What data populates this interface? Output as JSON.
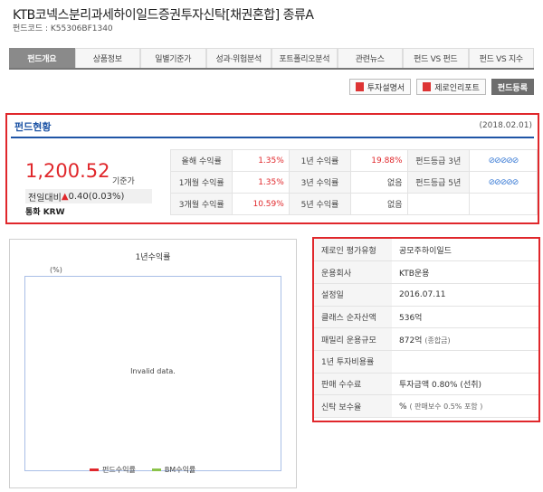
{
  "fund": {
    "name": "KTB코넥스분리과세하이일드증권투자신탁[채권혼합] 종류A",
    "code_label": "펀드코드 : K55306BF1340"
  },
  "tabs": [
    "펀드개요",
    "상품정보",
    "일별기준가",
    "성과·위험분석",
    "포트폴리오분석",
    "관련뉴스",
    "펀드 VS 펀드",
    "펀드 VS 지수"
  ],
  "buttons": {
    "prospectus": "투자설명서",
    "zeroin_report": "제로인리포트",
    "register": "펀드등록"
  },
  "status": {
    "title": "펀드현황",
    "date": "(2018.02.01)",
    "price": "1,200.52",
    "price_label": "기준가",
    "change_label": "전일대비",
    "change_arrow": "▲",
    "change_value": "0.40(0.03%)",
    "currency": "통화 KRW",
    "returns": {
      "ytd_label": "올해 수익률",
      "ytd": "1.35%",
      "y1_label": "1년 수익률",
      "y1": "19.88%",
      "grade3_label": "펀드등급 3년",
      "grade3": "⊘⊘⊘⊘⊘",
      "m1_label": "1개월 수익률",
      "m1": "1.35%",
      "y3_label": "3년 수익률",
      "y3": "없음",
      "grade5_label": "펀드등급 5년",
      "grade5": "⊘⊘⊘⊘⊘",
      "m3_label": "3개월 수익률",
      "m3": "10.59%",
      "y5_label": "5년 수익률",
      "y5": "없음"
    }
  },
  "chart": {
    "title": "1년수익률",
    "unit": "(%)",
    "message": "Invalid data.",
    "legend_fund": "펀드수익률",
    "legend_bm": "BM수익률",
    "fund_color": "#e0272b",
    "bm_color": "#8bc34a"
  },
  "info": {
    "rows": [
      {
        "label": "제로인 평가유형",
        "value": "공모주하이일드",
        "sub": ""
      },
      {
        "label": "운용회사",
        "value": "KTB운용",
        "sub": ""
      },
      {
        "label": "설정일",
        "value": "2016.07.11",
        "sub": ""
      },
      {
        "label": "클래스 순자산액",
        "value": "536억",
        "sub": ""
      },
      {
        "label": "패밀리 운용규모",
        "value": "872억",
        "sub": "(종합금)"
      },
      {
        "label": "1년 투자비용률",
        "value": "",
        "sub": ""
      },
      {
        "label": "판매 수수료",
        "value": "투자금액 0.80% (선취)",
        "sub": ""
      },
      {
        "label": "신탁 보수율",
        "value": "%",
        "sub": "( 판매보수 0.5% 포함 )"
      }
    ]
  }
}
